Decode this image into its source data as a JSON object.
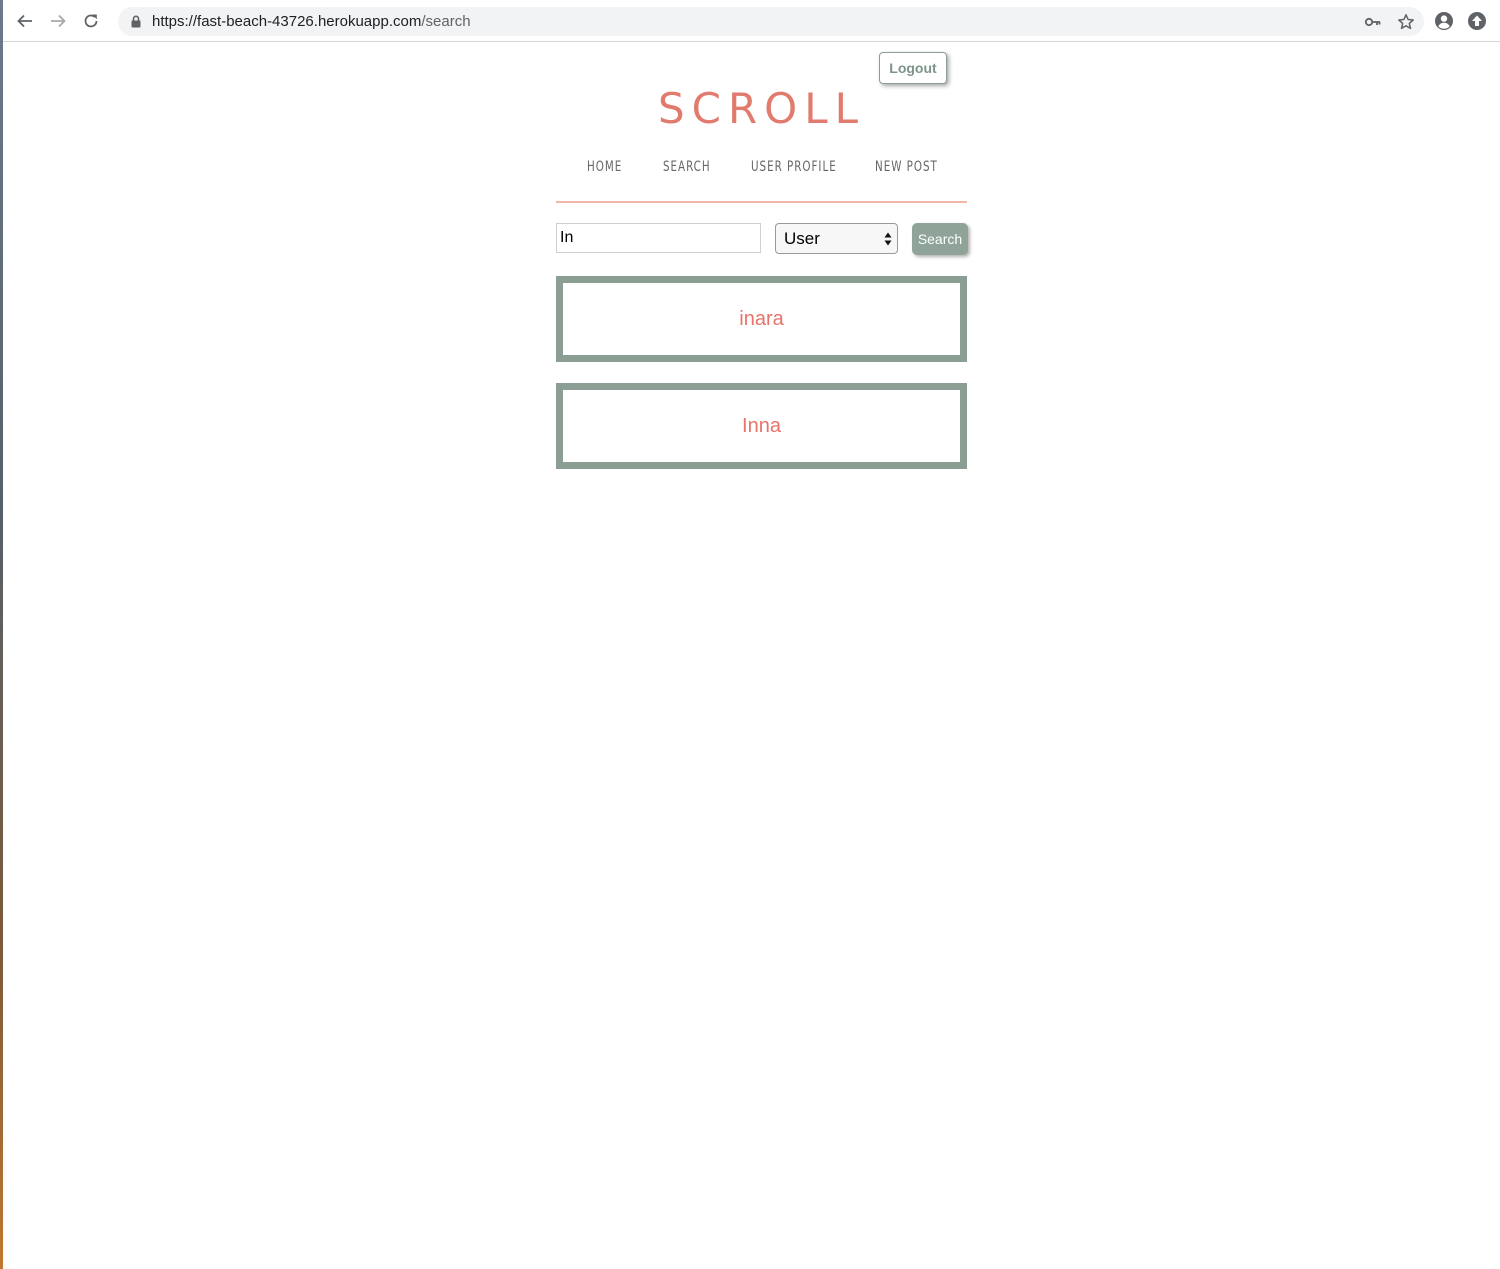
{
  "browser": {
    "url_host": "https://fast-beach-43726.herokuapp.com",
    "url_path": "/search",
    "icons": {
      "back": "arrow-left-icon",
      "forward": "arrow-right-icon",
      "reload": "reload-icon",
      "lock": "lock-icon",
      "key": "key-icon",
      "star": "star-icon",
      "profile": "account-circle-icon",
      "extension": "extension-icon"
    }
  },
  "header": {
    "logout_label": "Logout",
    "brand": "SCROLL"
  },
  "nav": {
    "items": [
      {
        "label": "HOME"
      },
      {
        "label": "SEARCH"
      },
      {
        "label": "USER PROFILE"
      },
      {
        "label": "NEW POST"
      }
    ]
  },
  "search": {
    "query": "In",
    "type_selected": "User",
    "button_label": "Search"
  },
  "results": [
    {
      "name": "inara"
    },
    {
      "name": "Inna"
    }
  ],
  "colors": {
    "brand": "#e07b6e",
    "accent_green": "#8a9e94",
    "result_text": "#e8736a",
    "nav_rule": "#f0b6a8"
  }
}
